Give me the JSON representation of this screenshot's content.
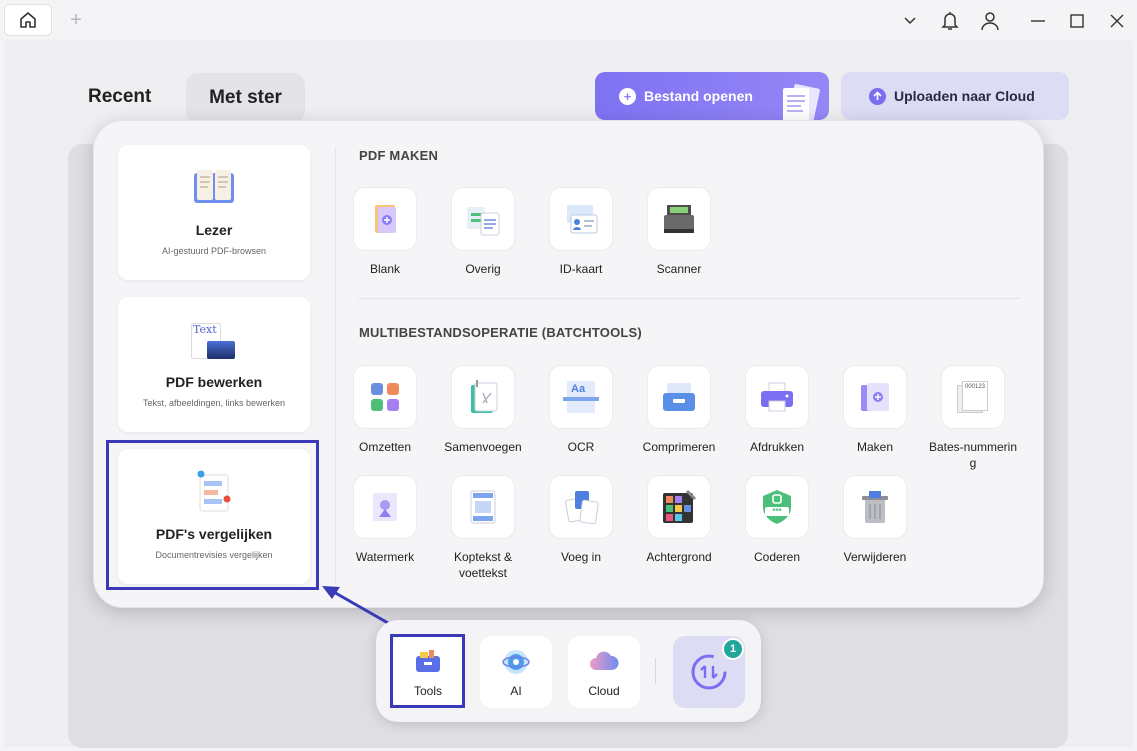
{
  "titlebar": {
    "home_icon": "home-icon",
    "new_tab": "+",
    "controls": [
      "chevron-down-icon",
      "bell-icon",
      "user-icon",
      "minimize-icon",
      "maximize-icon",
      "close-icon"
    ]
  },
  "header": {
    "tab_recent": "Recent",
    "tab_starred": "Met ster",
    "open_file_label": "Bestand openen",
    "upload_label": "Uploaden naar Cloud"
  },
  "tools_panel": {
    "cards": [
      {
        "title": "Lezer",
        "subtitle": "AI-gestuurd PDF-browsen",
        "icon": "book-icon"
      },
      {
        "title": "PDF bewerken",
        "subtitle": "Tekst, afbeeldingen, links bewerken",
        "icon": "edit-text-icon",
        "icon_text": "Text"
      },
      {
        "title": "PDF's vergelijken",
        "subtitle": "Documentrevisies vergelijken",
        "icon": "compare-icon"
      }
    ],
    "section_create": {
      "title": "PDF MAKEN",
      "items": [
        {
          "label": "Blank",
          "icon": "blank-pdf-icon"
        },
        {
          "label": "Overig",
          "icon": "other-files-icon"
        },
        {
          "label": "ID-kaart",
          "icon": "id-card-icon"
        },
        {
          "label": "Scanner",
          "icon": "scanner-icon"
        }
      ]
    },
    "section_batch": {
      "title": "MULTIBESTANDSOPERATIE (BATCHTOOLS)",
      "items": [
        {
          "label": "Omzetten",
          "icon": "convert-icon"
        },
        {
          "label": "Samenvoegen",
          "icon": "merge-icon"
        },
        {
          "label": "OCR",
          "icon": "ocr-icon",
          "icon_text": "Aa"
        },
        {
          "label": "Comprimeren",
          "icon": "compress-icon"
        },
        {
          "label": "Afdrukken",
          "icon": "print-icon"
        },
        {
          "label": "Maken",
          "icon": "create-icon"
        },
        {
          "label": "Bates-nummering",
          "icon": "bates-icon",
          "icon_text": "000123"
        },
        {
          "label": "Watermerk",
          "icon": "watermark-icon"
        },
        {
          "label": "Koptekst & voettekst",
          "icon": "header-footer-icon"
        },
        {
          "label": "Voeg in",
          "icon": "insert-icon"
        },
        {
          "label": "Achtergrond",
          "icon": "background-icon"
        },
        {
          "label": "Coderen",
          "icon": "encrypt-icon",
          "icon_text": "***"
        },
        {
          "label": "Verwijderen",
          "icon": "trash-icon"
        }
      ]
    }
  },
  "dock": {
    "items": [
      {
        "label": "Tools",
        "icon": "toolbox-icon"
      },
      {
        "label": "AI",
        "icon": "ai-icon"
      },
      {
        "label": "Cloud",
        "icon": "cloud-icon"
      }
    ],
    "sync_badge": "1"
  },
  "colors": {
    "accent": "#8b7ef4",
    "highlight": "#3a3ab8",
    "badge": "#22a89a"
  }
}
